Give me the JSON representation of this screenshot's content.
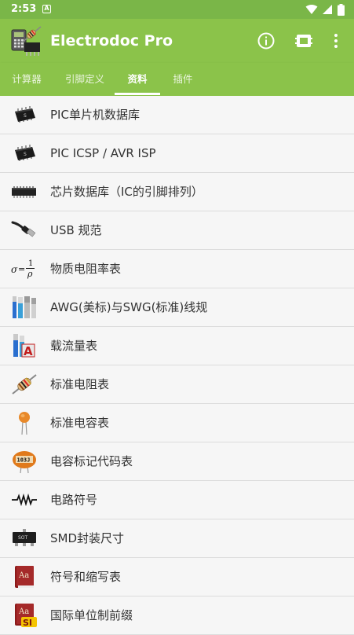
{
  "status_bar": {
    "time": "2:53",
    "notification_glyph": "A",
    "icons": [
      "wifi-icon",
      "signal-icon",
      "battery-icon"
    ]
  },
  "app_bar": {
    "title": "Electrodoc Pro",
    "logo": "electrodoc-logo",
    "actions": [
      "info-icon",
      "chip-icon",
      "more-vert-icon"
    ],
    "background": "#8bc34a"
  },
  "tabs": [
    {
      "label": "计算器",
      "active": false
    },
    {
      "label": "引脚定义",
      "active": false
    },
    {
      "label": "资料",
      "active": true
    },
    {
      "label": "插件",
      "active": false
    }
  ],
  "list_items": [
    {
      "label": "PIC单片机数据库",
      "icon": "pic-chip-icon"
    },
    {
      "label": "PIC ICSP / AVR ISP",
      "icon": "pic-chip-icon"
    },
    {
      "label": "芯片数据库（IC的引脚排列）",
      "icon": "dip-ic-icon"
    },
    {
      "label": "USB 规范",
      "icon": "usb-cable-icon"
    },
    {
      "label": "物质电阻率表",
      "icon": "resistivity-formula-icon",
      "icon_text": {
        "sigma": "σ",
        "eq": "=",
        "num": "1",
        "den": "ρ"
      }
    },
    {
      "label": "AWG(美标)与SWG(标准)线规",
      "icon": "wire-gauge-icon"
    },
    {
      "label": "载流量表",
      "icon": "ampacity-icon",
      "icon_text": "A"
    },
    {
      "label": "标准电阻表",
      "icon": "resistor-icon"
    },
    {
      "label": "标准电容表",
      "icon": "ceramic-capacitor-icon"
    },
    {
      "label": "电容标记代码表",
      "icon": "capacitor-code-icon",
      "icon_text": "103J"
    },
    {
      "label": "电路符号",
      "icon": "resistor-symbol-icon"
    },
    {
      "label": "SMD封装尺寸",
      "icon": "smd-package-icon",
      "icon_text": "SOT"
    },
    {
      "label": "符号和缩写表",
      "icon": "book-icon",
      "icon_text": "Aa"
    },
    {
      "label": "国际单位制前缀",
      "icon": "si-book-icon",
      "icon_text": {
        "aa": "Aa",
        "si": "SI"
      }
    }
  ]
}
